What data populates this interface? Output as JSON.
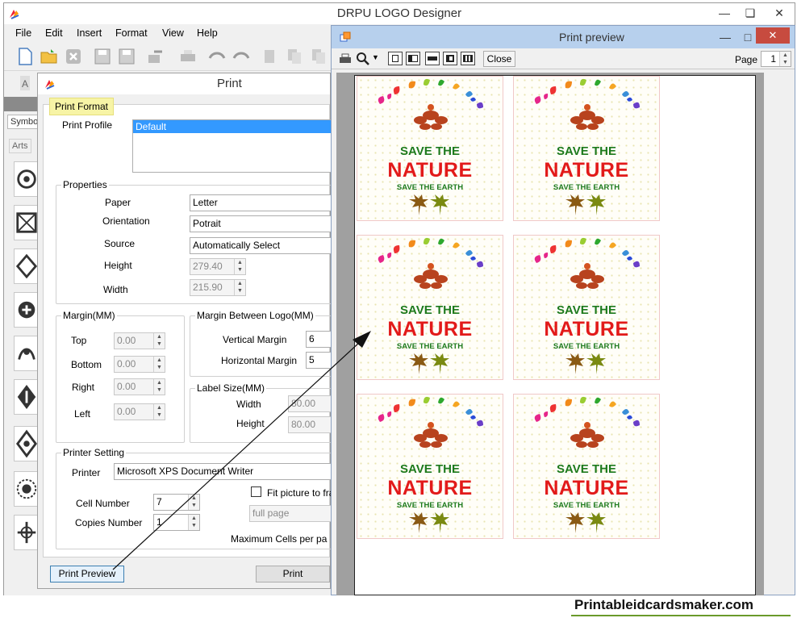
{
  "app": {
    "title": "DRPU LOGO Designer",
    "win_min": "—",
    "win_max": "❏",
    "win_close": "✕"
  },
  "menu": [
    "File",
    "Edit",
    "Insert",
    "Format",
    "View",
    "Help"
  ],
  "left_panel": {
    "tab_symbols": "Symbo",
    "tab_arts": "Arts"
  },
  "print_dialog": {
    "title": "Print",
    "tab": "Print Format",
    "print_profile": {
      "label": "Print Profile",
      "selected": "Default"
    },
    "properties": {
      "group": "Properties",
      "paper": {
        "label": "Paper",
        "value": "Letter"
      },
      "orientation": {
        "label": "Orientation",
        "value": "Potrait"
      },
      "source": {
        "label": "Source",
        "value": "Automatically Select"
      },
      "height": {
        "label": "Height",
        "value": "279.40"
      },
      "width": {
        "label": "Width",
        "value": "215.90"
      }
    },
    "margin": {
      "group": "Margin(MM)",
      "top": {
        "label": "Top",
        "value": "0.00"
      },
      "bottom": {
        "label": "Bottom",
        "value": "0.00"
      },
      "right": {
        "label": "Right",
        "value": "0.00"
      },
      "left": {
        "label": "Left",
        "value": "0.00"
      }
    },
    "margin_between": {
      "group": "Margin Between Logo(MM)",
      "vertical": {
        "label": "Vertical Margin",
        "value": "6"
      },
      "horizontal": {
        "label": "Horizontal Margin",
        "value": "5"
      }
    },
    "label_size": {
      "group": "Label Size(MM)",
      "width": {
        "label": "Width",
        "value": "80.00"
      },
      "height": {
        "label": "Height",
        "value": "80.00"
      }
    },
    "printer_setting": {
      "group": "Printer Setting",
      "printer": {
        "label": "Printer",
        "value": "Microsoft XPS Document Writer"
      },
      "fit_picture": "Fit picture to fra",
      "fit_mode": "full page",
      "cell_number": {
        "label": "Cell Number",
        "value": "7"
      },
      "copies_number": {
        "label": "Copies Number",
        "value": "1"
      },
      "max_cells": "Maximum Cells per pa"
    },
    "btn_preview": "Print Preview",
    "btn_print": "Print"
  },
  "preview": {
    "title": "Print preview",
    "close_btn": "Close",
    "page_label": "Page",
    "page_value": "1",
    "win_min": "—",
    "win_max": "□",
    "win_close": "✕"
  },
  "logo": {
    "line1": "SAVE THE",
    "line2": "NATURE",
    "line3": "SAVE THE EARTH"
  },
  "watermark": "Printableidcardsmaker.com"
}
